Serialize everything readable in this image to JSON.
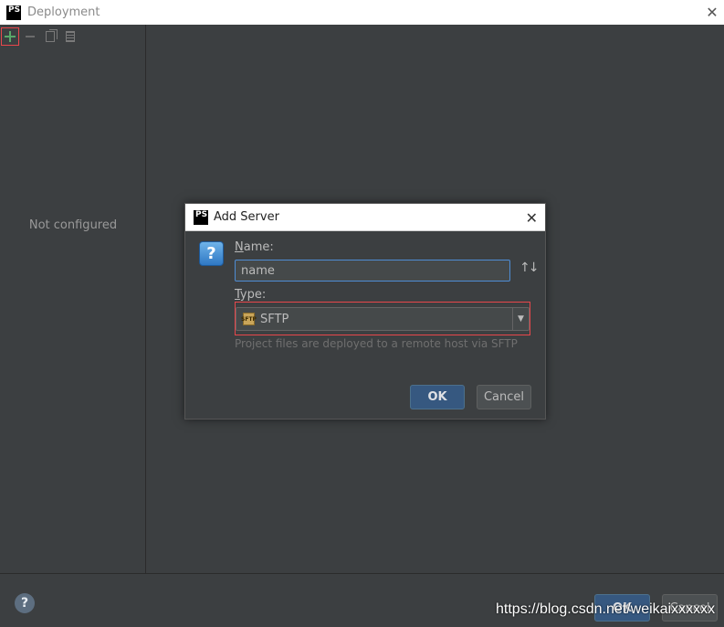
{
  "window": {
    "logo_text": "PS",
    "title": "Deployment",
    "close_glyph": "✕"
  },
  "left_panel": {
    "toolbar_icons": [
      "add-icon",
      "remove-icon",
      "copy-icon",
      "list-icon"
    ],
    "empty_text": "Not configured"
  },
  "footer": {
    "help_glyph": "?",
    "ok_label": "OK",
    "cancel_label": "Cancel",
    "watermark": "https://blog.csdn.net/weikaixxxxxx"
  },
  "dialog": {
    "logo_text": "PS",
    "title": "Add Server",
    "close_glyph": "✕",
    "question_glyph": "?",
    "name_label_mnemonic": "N",
    "name_label_rest": "ame:",
    "name_value": "name",
    "sort_glyph": "↑↓",
    "type_label_mnemonic": "T",
    "type_label_rest": "ype:",
    "type_icon_text": "SFTP",
    "type_value": "SFTP",
    "type_hint": "Project files are deployed to a remote host via SFTP",
    "ok_label": "OK",
    "cancel_label": "Cancel"
  },
  "colors": {
    "accent_blue": "#365880",
    "highlight_red": "#e8474b",
    "panel_bg": "#3c3f41"
  }
}
